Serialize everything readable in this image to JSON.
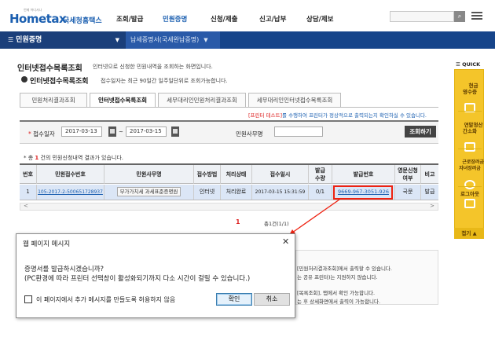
{
  "header": {
    "logo_main": "Hometax",
    "logo_kr": "국세청홈택스",
    "logo_sub": "언제 어디서나",
    "nav": [
      "조회/발급",
      "민원증명",
      "신청/제출",
      "신고/납부",
      "상담/제보"
    ]
  },
  "breadcrumb": {
    "home": "민원증명",
    "sub": "납세증명서(국세완납증명)"
  },
  "page": {
    "title": "인터넷접수목록조회",
    "title_desc": "인터넷으로 신청한 민원내역을 조회하는 화면입니다.",
    "subtitle": "인터넷접수목록조회",
    "subtitle_desc": "접수일자는 최근 90일간 일주일단위로 조회가능합니다."
  },
  "tabs": [
    "민원처리결과조회",
    "인터넷접수목록조회",
    "세무대리인민원처리결과조회",
    "세무대리인인터넷접수목록조회"
  ],
  "notice": {
    "red": "[프린터 테스트]",
    "text": "를 수행하여 프린터가 정상적으로 출력되는지 확인하실 수 있습니다."
  },
  "search": {
    "label": "접수일자",
    "required_mark": "*",
    "date_from": "2017-03-13",
    "date_to": "2017-03-15",
    "tilde": "~",
    "office_label": "민원사무명",
    "office_value": "",
    "button": "조회하기"
  },
  "result": {
    "prefix": "* 총",
    "count": "1",
    "suffix": "건의 민원신청내역 결과가 있습니다."
  },
  "grid": {
    "headers": [
      "번호",
      "민원접수번호",
      "민원사무명",
      "접수방법",
      "처리상태",
      "접수일시",
      "발급\n수량",
      "발급번호",
      "영문신청\n여부",
      "비고"
    ],
    "rows": [
      [
        "1",
        "105-2017-2-500651728937",
        "부가가치세 과세표준증명원",
        "인터넷",
        "처리완료",
        "2017-03-15 15:31:59",
        "0/1",
        "9669-967-3051-926",
        "국문",
        "발급"
      ]
    ]
  },
  "pager": {
    "current": "1",
    "total": "총1건(1/1)"
  },
  "info_lines": [
    "[민원처리결과조회]에서 출력할 수 있습니다.",
    "는 공유 프린터)는 지원하지 않습니다.",
    "",
    "[목록조회], 탭에서 확인 가능합니다.",
    "는 후 상세화면에서 출력이 가능합니다."
  ],
  "quick": {
    "title": "QUICK",
    "items": [
      "현금\n영수증",
      "연말정산\n간소화",
      "근로장려금\n자녀장려금",
      "로그아웃"
    ],
    "footer": "접기"
  },
  "dialog": {
    "title": "웹 페이지 메시지",
    "close": "✕",
    "message1": "증명서를 발급하시겠습니까?",
    "message2": "(PC환경에 따라 프린터 선택창이 활성화되기까지 다소 시간이 걸릴 수 있습니다.)",
    "checkbox_label": "이 페이지에서 추가 메시지를 만들도록 허용하지 않음",
    "ok": "확인",
    "cancel": "취소"
  },
  "colors": {
    "brand_blue": "#16448a",
    "quick_yellow": "#f4c52a",
    "highlight_red": "#e21"
  }
}
